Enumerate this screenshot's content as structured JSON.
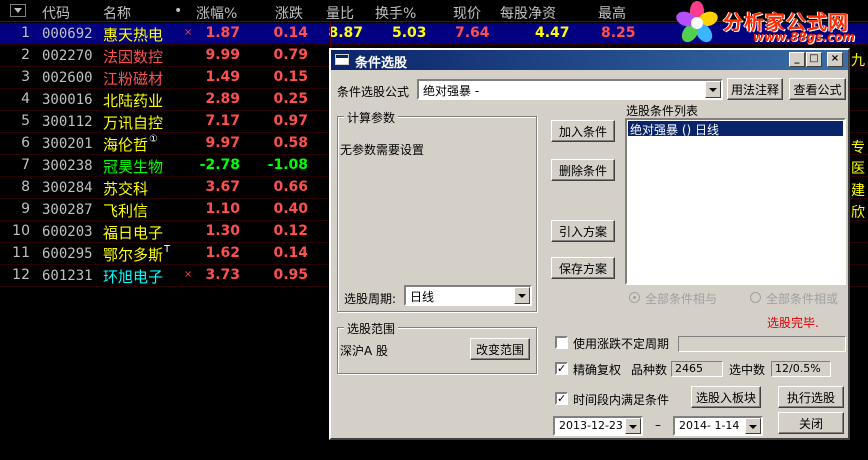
{
  "grid": {
    "headers": {
      "code": "代码",
      "name": "名称",
      "dot": "•",
      "pct": "涨幅%",
      "chg": "涨跌",
      "vr": "量比",
      "turnover": "换手%",
      "price": "现价",
      "nav": "每股净资",
      "high": "最高"
    },
    "rows": [
      {
        "num": "1",
        "code": "000692",
        "name": "惠天热电",
        "mark": "×",
        "pct": "1.87",
        "chg": "0.14",
        "vr": "8.87",
        "dir": "up",
        "name_color": "#ffff00"
      },
      {
        "num": "2",
        "code": "002270",
        "name": "法因数控",
        "mark": "",
        "pct": "9.99",
        "chg": "0.79",
        "vr": "",
        "dir": "up",
        "name_color": "#ff5050"
      },
      {
        "num": "3",
        "code": "002600",
        "name": "江粉磁材",
        "mark": "",
        "pct": "1.49",
        "chg": "0.15",
        "vr": "",
        "dir": "up",
        "name_color": "#ff5050"
      },
      {
        "num": "4",
        "code": "300016",
        "name": "北陆药业",
        "mark": "",
        "pct": "2.89",
        "chg": "0.25",
        "vr": "",
        "dir": "up",
        "name_color": "#ffff00"
      },
      {
        "num": "5",
        "code": "300112",
        "name": "万讯自控",
        "mark": "",
        "pct": "7.17",
        "chg": "0.97",
        "vr": "",
        "dir": "up",
        "name_color": "#ffff00"
      },
      {
        "num": "6",
        "code": "300201",
        "name": "海伦哲",
        "sup": "①",
        "mark": "",
        "pct": "9.97",
        "chg": "0.58",
        "vr": "",
        "dir": "up",
        "name_color": "#ffff00"
      },
      {
        "num": "7",
        "code": "300238",
        "name": "冠昊生物",
        "mark": "",
        "pct": "-2.78",
        "chg": "-1.08",
        "vr": "",
        "dir": "down",
        "name_color": "#00ff00"
      },
      {
        "num": "8",
        "code": "300284",
        "name": "苏交科",
        "mark": "",
        "pct": "3.67",
        "chg": "0.66",
        "vr": "",
        "dir": "up",
        "name_color": "#ffff00"
      },
      {
        "num": "9",
        "code": "300287",
        "name": "飞利信",
        "mark": "",
        "pct": "1.10",
        "chg": "0.40",
        "vr": "",
        "dir": "up",
        "name_color": "#ffff00"
      },
      {
        "num": "10",
        "code": "600203",
        "name": "福日电子",
        "mark": "",
        "pct": "1.30",
        "chg": "0.12",
        "vr": "",
        "dir": "up",
        "name_color": "#ffff00"
      },
      {
        "num": "11",
        "code": "600295",
        "name": "鄂尔多斯",
        "sup": "T",
        "mark": "",
        "pct": "1.62",
        "chg": "0.14",
        "vr": "",
        "dir": "up",
        "name_color": "#ffff00"
      },
      {
        "num": "12",
        "code": "601231",
        "name": "环旭电子",
        "mark": "×",
        "pct": "3.73",
        "chg": "0.95",
        "vr": "",
        "dir": "up",
        "name_color": "#00ffff"
      }
    ],
    "row1_extra": {
      "turnover": "5.03",
      "price": "7.64",
      "nav": "4.47",
      "high": "8.25"
    },
    "edge_chars": [
      "九",
      "专",
      "医",
      "建",
      "欣"
    ]
  },
  "logo": {
    "title": "分析家公式网",
    "url": "www.88gs.com"
  },
  "dialog": {
    "title": "条件选股",
    "formula_label": "条件选股公式",
    "formula_value": "绝对强暴 -",
    "usage_button": "用法注释",
    "view_button": "查看公式",
    "params_group": "计算参数",
    "params_text": "无参数需要设置",
    "add_button": "加入条件",
    "delete_button": "删除条件",
    "import_button": "引入方案",
    "save_button": "保存方案",
    "list_label": "选股条件列表",
    "list_items": [
      "绝对强暴  () 日线"
    ],
    "period_label": "选股周期:",
    "period_value": "日线",
    "radio_and": "全部条件相与",
    "radio_or": "全部条件相或",
    "status": "选股完毕.",
    "range_group": "选股范围",
    "range_text": "深沪A 股",
    "change_range_button": "改变范围",
    "use_uncertain_label": "使用涨跌不定周期",
    "exact_restore_label": "精确复权",
    "variety_label": "品种数",
    "variety_value": "2465",
    "selected_label": "选中数",
    "selected_value": "12/0.5%",
    "time_period_label": "时间段内满足条件",
    "to_block_button": "选股入板块",
    "execute_button": "执行选股",
    "date_from": "2013-12-23",
    "date_sep": "–",
    "date_to": "2014- 1-14",
    "close_button": "关闭"
  }
}
